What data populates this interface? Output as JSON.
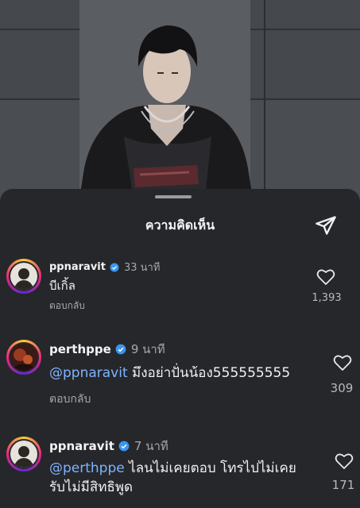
{
  "sheet": {
    "title": "ความคิดเห็น"
  },
  "comments": [
    {
      "username": "ppnaravit",
      "time": "33 นาที",
      "text": "บีเกิ้ล",
      "mention": "",
      "reply_label": "ตอบกลับ",
      "likes": "1,393",
      "verified": true
    },
    {
      "username": "perthppe",
      "time": "9 นาที",
      "mention": "@ppnaravit",
      "text": " มึงอย่าปั่นน้อง555555555",
      "reply_label": "ตอบกลับ",
      "likes": "309",
      "verified": true
    },
    {
      "username": "ppnaravit",
      "time": "7 นาที",
      "mention": "@perthppe",
      "text": " ไลนไม่เคยตอบ โทรไปไม่เคย",
      "text_line2": "รับไม่มีสิทธิพูด",
      "likes": "171",
      "verified": true
    }
  ],
  "colors": {
    "background": "#26272b",
    "mention": "#7fb3ff",
    "verified": "#3897f0"
  },
  "icons": {
    "share": "paper-plane-icon",
    "like": "heart-outline-icon",
    "verified": "verified-badge-icon"
  }
}
